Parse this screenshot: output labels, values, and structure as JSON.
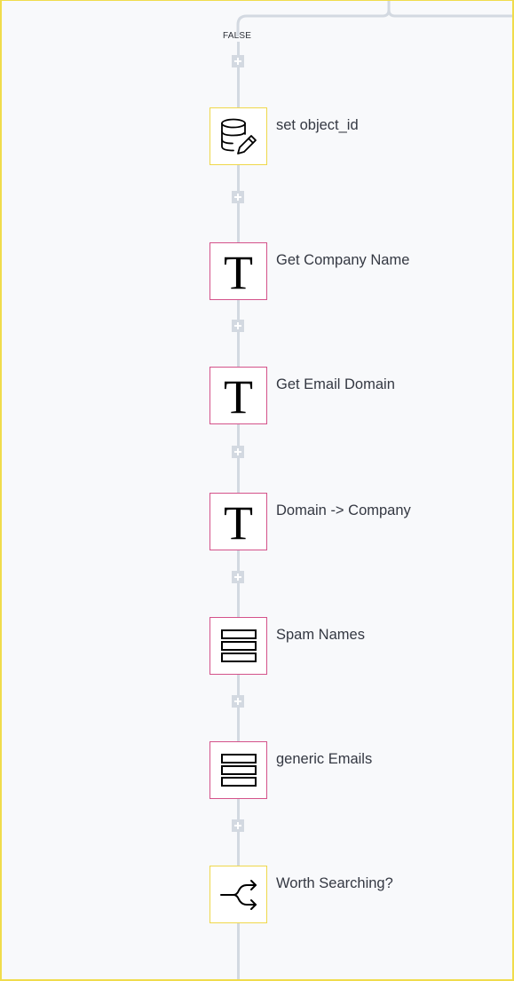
{
  "branch": {
    "label": "FALSE"
  },
  "colors": {
    "canvas_bg": "#f8f9fb",
    "connector": "#d3d9e1",
    "frame_border": "#f0dc4c",
    "logic_node_border": "#efd84a",
    "transform_node_border": "#d4528a"
  },
  "nodes": [
    {
      "label": "set object_id",
      "icon": "database-edit-icon",
      "kind": "logic"
    },
    {
      "label": "Get Company Name",
      "icon": "text-icon",
      "glyph": "T",
      "kind": "transform"
    },
    {
      "label": "Get Email Domain",
      "icon": "text-icon",
      "glyph": "T",
      "kind": "transform"
    },
    {
      "label": "Domain -> Company",
      "icon": "text-icon",
      "glyph": "T",
      "kind": "transform"
    },
    {
      "label": "Spam Names",
      "icon": "list-icon",
      "kind": "transform"
    },
    {
      "label": "generic Emails",
      "icon": "list-icon",
      "kind": "transform"
    },
    {
      "label": "Worth Searching?",
      "icon": "branch-icon",
      "kind": "logic"
    }
  ]
}
